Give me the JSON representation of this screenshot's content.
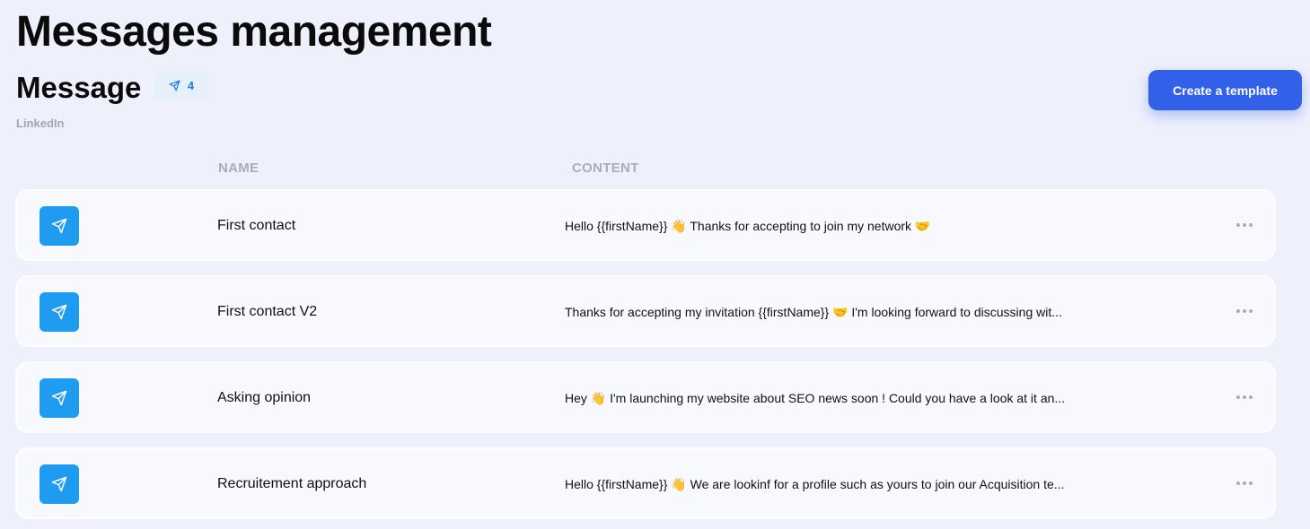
{
  "page": {
    "title": "Messages management"
  },
  "section": {
    "title": "Message",
    "count": "4",
    "subtitle": "LinkedIn",
    "count_icon": "send-icon"
  },
  "toolbar": {
    "create_label": "Create a template"
  },
  "table": {
    "headers": [
      "NAME",
      "CONTENT"
    ],
    "rows": [
      {
        "icon": "send-icon",
        "name": "First contact",
        "content": "Hello {{firstName}} 👋 Thanks for accepting to join my network 🤝",
        "menu_icon": "more-horizontal-icon"
      },
      {
        "icon": "send-icon",
        "name": "First contact V2",
        "content": "Thanks for accepting my invitation {{firstName}} 🤝 I'm looking forward to discussing wit...",
        "menu_icon": "more-horizontal-icon"
      },
      {
        "icon": "send-icon",
        "name": "Asking opinion",
        "content": "Hey 👋 I'm launching my website about SEO news soon ! Could you have a look at it an...",
        "menu_icon": "more-horizontal-icon"
      },
      {
        "icon": "send-icon",
        "name": "Recruitement approach",
        "content": "Hello {{firstName}} 👋 We are lookinf for a profile such as yours to join our Acquisition te...",
        "menu_icon": "more-horizontal-icon"
      }
    ]
  },
  "colors": {
    "background": "#eef0fb",
    "accent": "#3360e8",
    "icon_blue": "#1f9cf0",
    "badge_bg": "#e6f0fb",
    "badge_text": "#1f7ad9",
    "muted": "#a8acbd"
  }
}
